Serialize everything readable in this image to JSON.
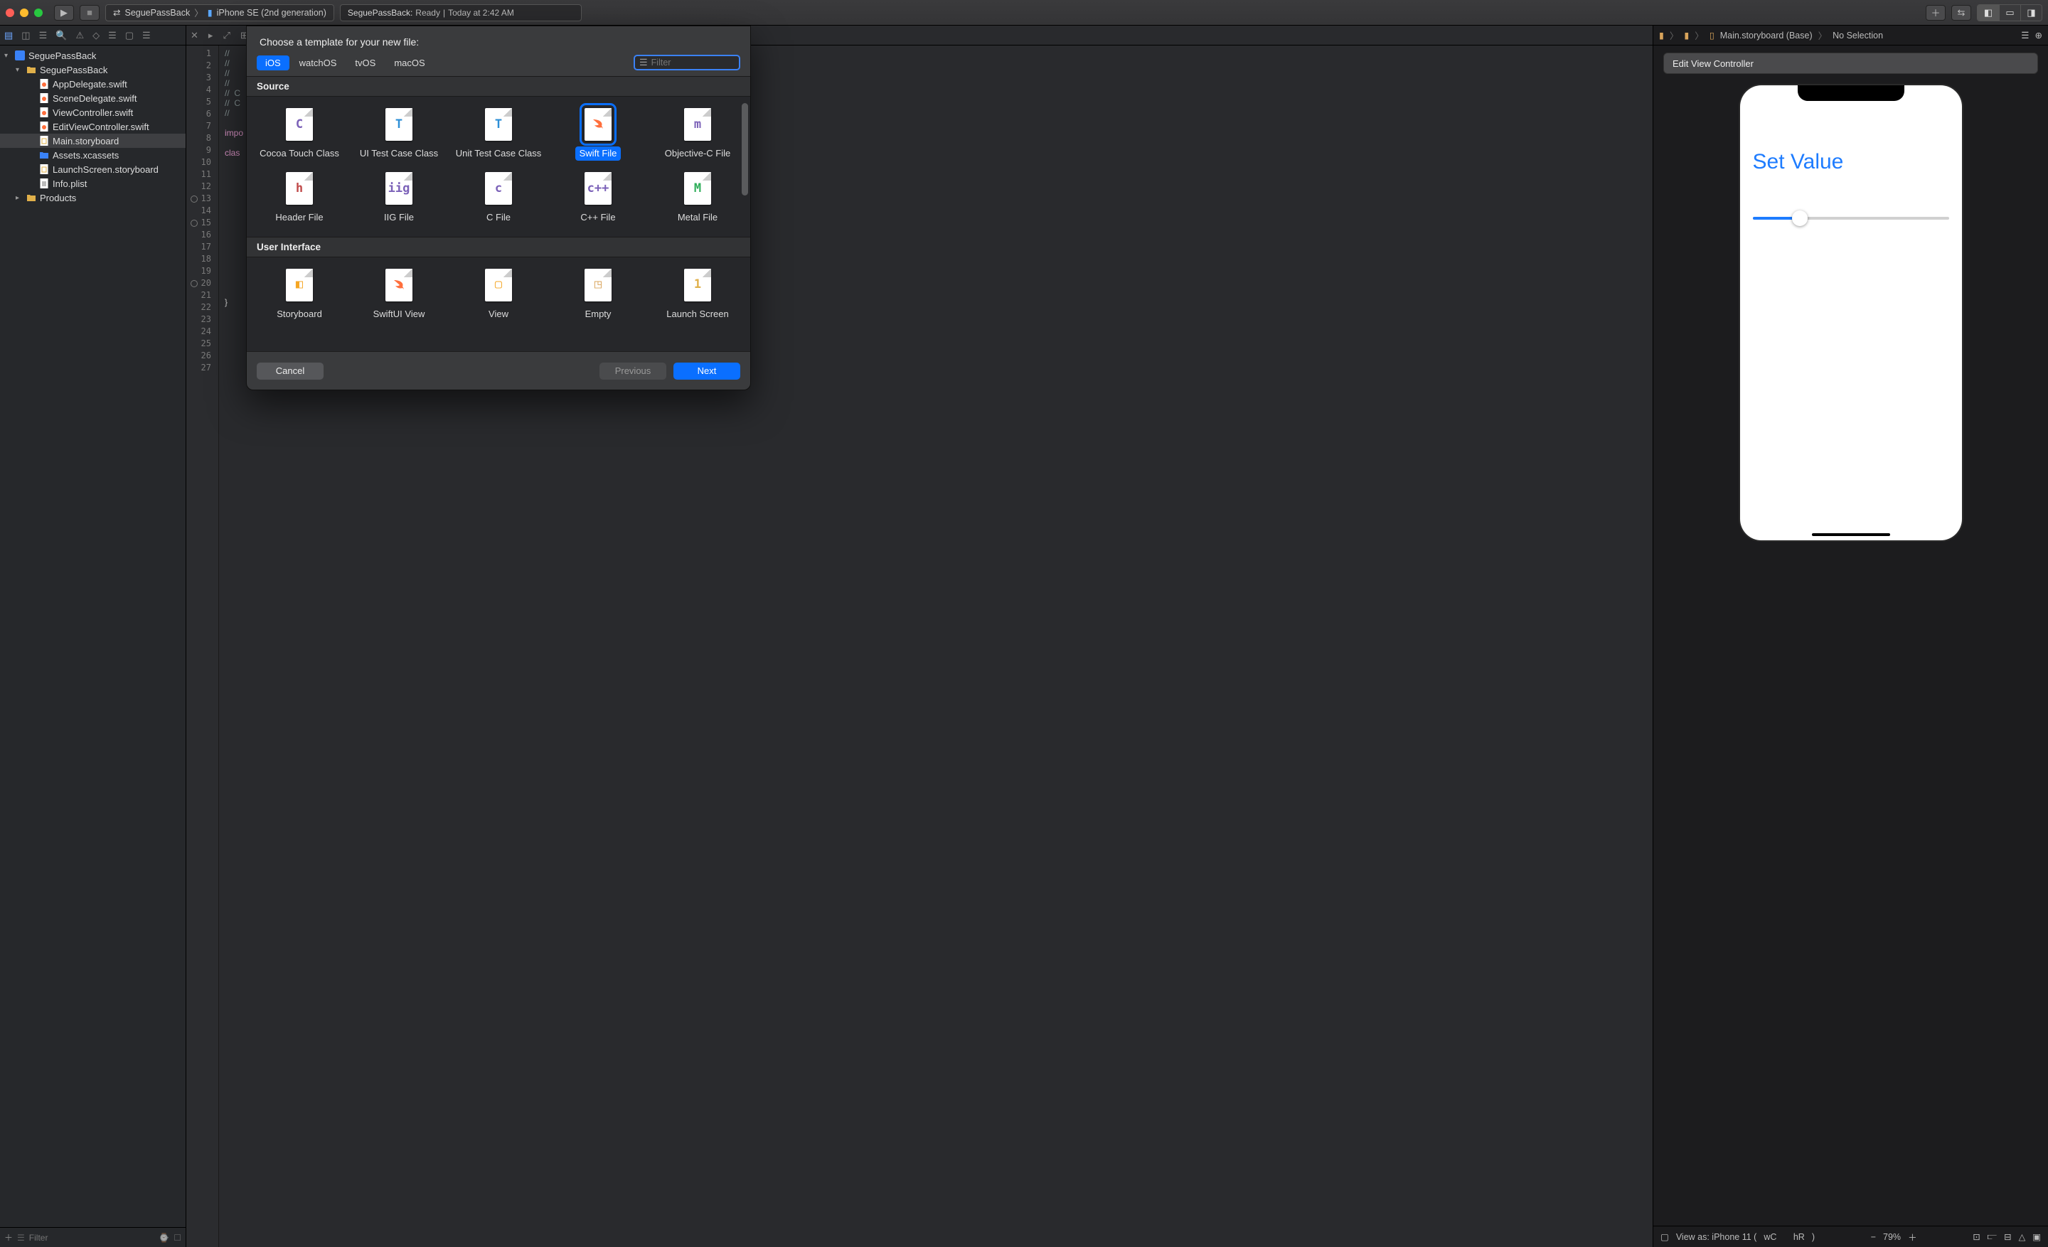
{
  "toolbar": {
    "scheme_project": "SeguePassBack",
    "scheme_device": "iPhone SE (2nd generation)",
    "status_project": "SeguePassBack:",
    "status_state": "Ready",
    "status_time": "Today at 2:42 AM"
  },
  "navigator": {
    "project": "SeguePassBack",
    "group": "SeguePassBack",
    "files_group": [
      "AppDelegate.swift",
      "SceneDelegate.swift",
      "ViewController.swift",
      "EditViewController.swift",
      "Main.storyboard",
      "Assets.xcassets",
      "LaunchScreen.storyboard",
      "Info.plist"
    ],
    "products": "Products",
    "filter_placeholder": "Filter"
  },
  "editor": {
    "lines": 27,
    "breakpoint_lines": [
      13,
      15,
      20
    ],
    "code": {
      "l1": "//",
      "l2": "//",
      "l3": "//",
      "l4": "//",
      "l5": "//  C",
      "l6": "//  C",
      "l7": "//",
      "l9": "impo",
      "l11": "clas",
      "l26": "}"
    }
  },
  "ib": {
    "jumpbar": [
      "Main.storyboard (Base)",
      "No Selection"
    ],
    "scene_title": "Edit View Controller",
    "button_label": "Set Value",
    "bottombar": {
      "view_as": "View as: iPhone 11 (",
      "wc": "wC",
      "hr": "hR",
      "zoom": "79%"
    }
  },
  "sheet": {
    "title": "Choose a template for your new file:",
    "platforms": [
      "iOS",
      "watchOS",
      "tvOS",
      "macOS"
    ],
    "active_platform": "iOS",
    "filter_placeholder": "Filter",
    "sections": {
      "source": {
        "header": "Source",
        "items": [
          {
            "label": "Cocoa Touch Class",
            "glyph": "C",
            "cls": "c"
          },
          {
            "label": "UI Test Case Class",
            "glyph": "T",
            "cls": "t"
          },
          {
            "label": "Unit Test Case Class",
            "glyph": "T",
            "cls": "t"
          },
          {
            "label": "Swift File",
            "glyph": "",
            "cls": "sw",
            "selected": true
          },
          {
            "label": "Objective-C File",
            "glyph": "m",
            "cls": "m"
          },
          {
            "label": "Header File",
            "glyph": "h",
            "cls": "h"
          },
          {
            "label": "IIG File",
            "glyph": "iig",
            "cls": "iig"
          },
          {
            "label": "C File",
            "glyph": "c",
            "cls": "cc"
          },
          {
            "label": "C++ File",
            "glyph": "c++",
            "cls": "cpp"
          },
          {
            "label": "Metal File",
            "glyph": "M",
            "cls": "met"
          }
        ]
      },
      "ui": {
        "header": "User Interface",
        "items": [
          {
            "label": "Storyboard",
            "glyph": "",
            "cls": "sb"
          },
          {
            "label": "SwiftUI View",
            "glyph": "",
            "cls": "sw"
          },
          {
            "label": "View",
            "glyph": "",
            "cls": "vw"
          },
          {
            "label": "Empty",
            "glyph": "",
            "cls": "emp"
          },
          {
            "label": "Launch Screen",
            "glyph": "1",
            "cls": "ls"
          }
        ]
      }
    },
    "buttons": {
      "cancel": "Cancel",
      "previous": "Previous",
      "next": "Next"
    }
  }
}
